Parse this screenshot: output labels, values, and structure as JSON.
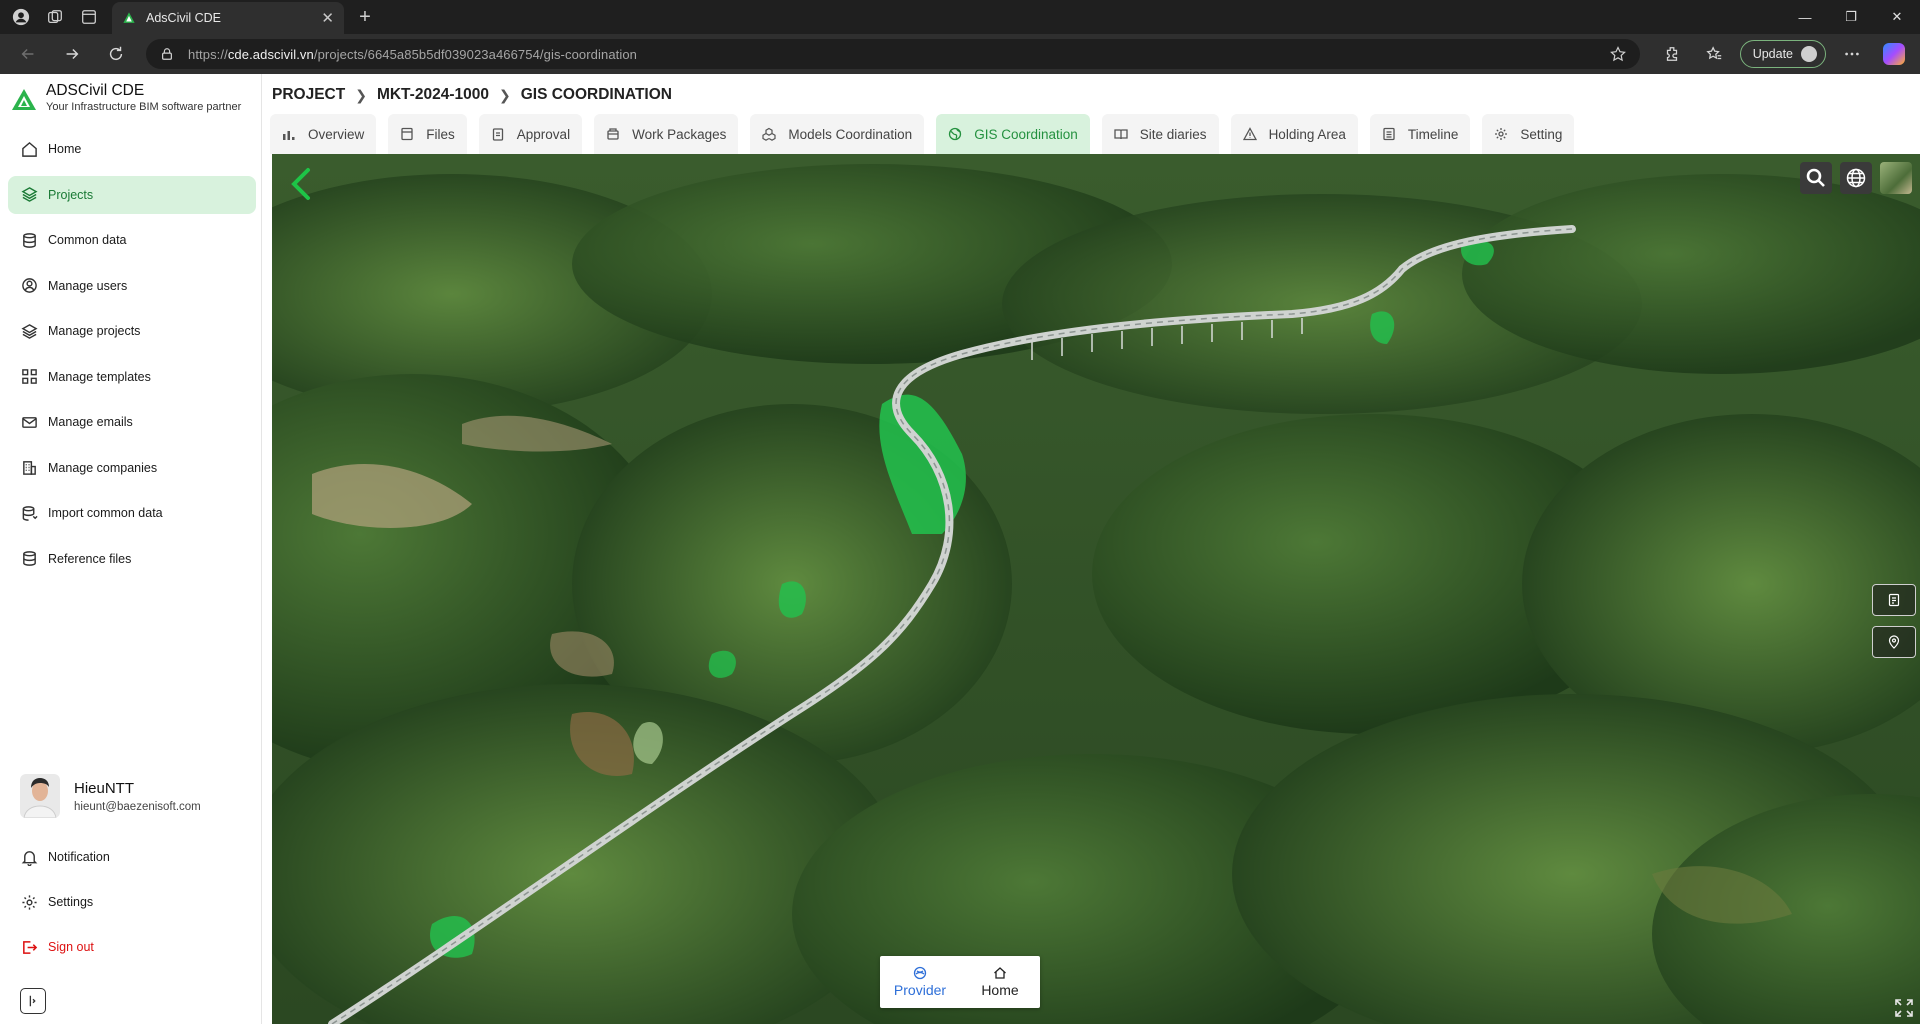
{
  "browser": {
    "tab_title": "AdsCivil CDE",
    "url_host": "cde.adscivil.vn",
    "url_scheme": "https://",
    "url_path": "/projects/6645a85b5df039023a466754/gis-coordination",
    "update_label": "Update"
  },
  "brand": {
    "name": "ADSCivil CDE",
    "tagline": "Your Infrastructure BIM software partner",
    "accent": "#1a7a35"
  },
  "sidebar": {
    "items": [
      {
        "label": "Home",
        "icon": "home-icon"
      },
      {
        "label": "Projects",
        "icon": "layers-icon",
        "active": true
      },
      {
        "label": "Common data",
        "icon": "database-icon"
      },
      {
        "label": "Manage users",
        "icon": "user-circle-icon"
      },
      {
        "label": "Manage projects",
        "icon": "layers-icon"
      },
      {
        "label": "Manage templates",
        "icon": "grid-icon"
      },
      {
        "label": "Manage emails",
        "icon": "mail-icon"
      },
      {
        "label": "Manage companies",
        "icon": "building-icon"
      },
      {
        "label": "Import common data",
        "icon": "database-import-icon"
      },
      {
        "label": "Reference files",
        "icon": "database-icon"
      }
    ],
    "user": {
      "name": "HieuNTT",
      "email": "hieunt@baezenisoft.com"
    },
    "bottom_items": [
      {
        "label": "Notification",
        "icon": "bell-icon"
      },
      {
        "label": "Settings",
        "icon": "gear-icon"
      },
      {
        "label": "Sign out",
        "icon": "sign-out-icon"
      }
    ]
  },
  "breadcrumb": {
    "project": "PROJECT",
    "code": "MKT-2024-1000",
    "page": "GIS COORDINATION"
  },
  "tabs": [
    {
      "label": "Overview",
      "icon": "bar-chart-icon"
    },
    {
      "label": "Files",
      "icon": "file-icon"
    },
    {
      "label": "Approval",
      "icon": "clipboard-icon"
    },
    {
      "label": "Work Packages",
      "icon": "package-icon"
    },
    {
      "label": "Models Coordination",
      "icon": "cubes-icon"
    },
    {
      "label": "GIS Coordination",
      "icon": "globe-icon",
      "active": true
    },
    {
      "label": "Site diaries",
      "icon": "book-icon"
    },
    {
      "label": "Holding Area",
      "icon": "warning-icon"
    },
    {
      "label": "Timeline",
      "icon": "list-icon"
    },
    {
      "label": "Setting",
      "icon": "gear-icon"
    }
  ],
  "map": {
    "bottom_card": {
      "provider_label": "Provider",
      "home_label": "Home"
    }
  }
}
